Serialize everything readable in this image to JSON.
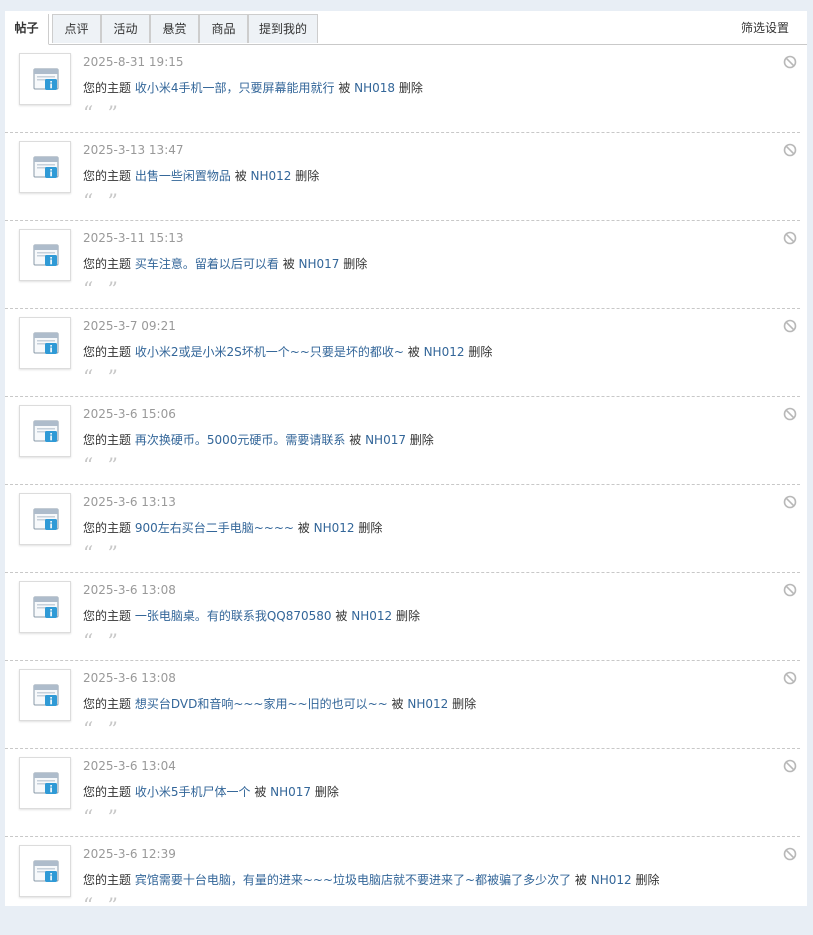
{
  "tabs": [
    {
      "label": "帖子",
      "active": true
    },
    {
      "label": "点评"
    },
    {
      "label": "活动"
    },
    {
      "label": "悬赏"
    },
    {
      "label": "商品"
    },
    {
      "label": "提到我的"
    }
  ],
  "filter_label": "筛选设置",
  "notifications": [
    {
      "time": "2025-8-31 19:15",
      "prefix": "您的主题",
      "title": "收小米4手机一部，只要屏幕能用就行",
      "by": "被",
      "user": "NH018",
      "action": "删除"
    },
    {
      "time": "2025-3-13 13:47",
      "prefix": "您的主题",
      "title": "出售一些闲置物品",
      "by": "被",
      "user": "NH012",
      "action": "删除"
    },
    {
      "time": "2025-3-11 15:13",
      "prefix": "您的主题",
      "title": "买车注意。留着以后可以看",
      "by": "被",
      "user": "NH017",
      "action": "删除"
    },
    {
      "time": "2025-3-7 09:21",
      "prefix": "您的主题",
      "title": "收小米2或是小米2S坏机一个~~只要是坏的都收~",
      "by": "被",
      "user": "NH012",
      "action": "删除"
    },
    {
      "time": "2025-3-6 15:06",
      "prefix": "您的主题",
      "title": "再次换硬币。5000元硬币。需要请联系",
      "by": "被",
      "user": "NH017",
      "action": "删除"
    },
    {
      "time": "2025-3-6 13:13",
      "prefix": "您的主题",
      "title": "900左右买台二手电脑~~~~",
      "by": "被",
      "user": "NH012",
      "action": "删除"
    },
    {
      "time": "2025-3-6 13:08",
      "prefix": "您的主题",
      "title": "一张电脑桌。有的联系我QQ870580",
      "by": "被",
      "user": "NH012",
      "action": "删除"
    },
    {
      "time": "2025-3-6 13:08",
      "prefix": "您的主题",
      "title": "想买台DVD和音响~~~家用~~旧的也可以~~",
      "by": "被",
      "user": "NH012",
      "action": "删除"
    },
    {
      "time": "2025-3-6 13:04",
      "prefix": "您的主题",
      "title": "收小米5手机尸体一个",
      "by": "被",
      "user": "NH017",
      "action": "删除"
    },
    {
      "time": "2025-3-6 12:39",
      "prefix": "您的主题",
      "title": "宾馆需要十台电脑，有量的进来~~~垃圾电脑店就不要进来了~都被骗了多少次了",
      "by": "被",
      "user": "NH012",
      "action": "删除"
    }
  ],
  "quote_marks": "“ ”",
  "colors": {
    "link": "#336699",
    "time": "#999999",
    "background": "#e8eef5"
  }
}
